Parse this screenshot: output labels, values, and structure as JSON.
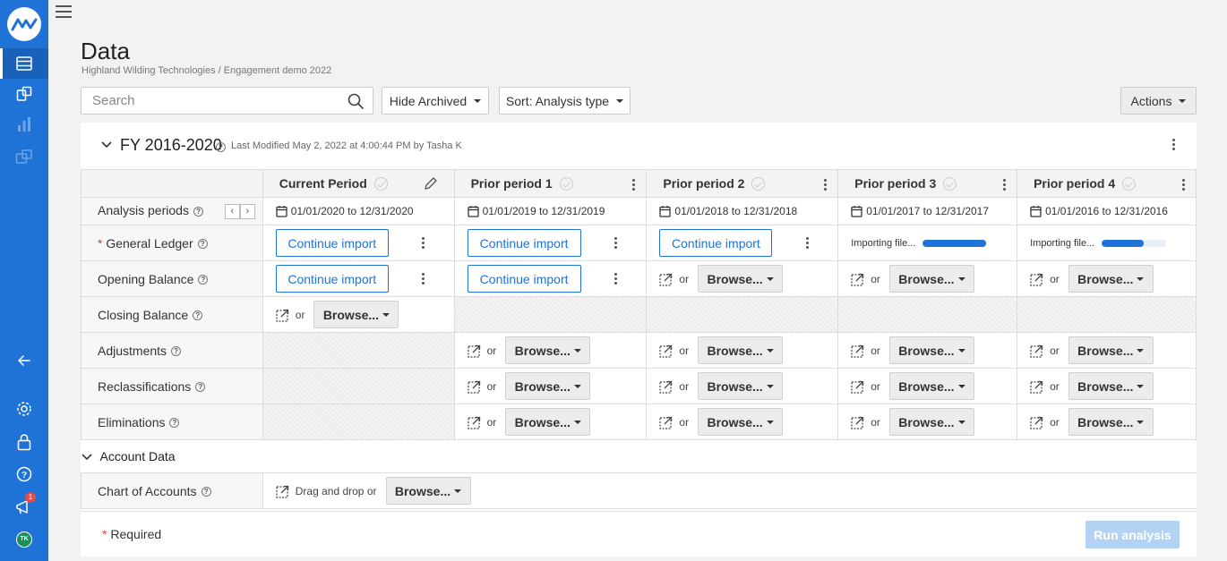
{
  "page": {
    "title": "Data",
    "breadcrumb": "Highland Wilding Technologies / Engagement demo 2022"
  },
  "toolbar": {
    "search_placeholder": "Search",
    "hide_archived": "Hide Archived",
    "sort": "Sort: Analysis type",
    "actions": "Actions"
  },
  "group": {
    "title": "FY 2016-2020",
    "meta": "Last Modified May 2, 2022 at 4:00:44 PM by Tasha K"
  },
  "columns": [
    {
      "label": "Current Period",
      "range": "01/01/2020 to 12/31/2020"
    },
    {
      "label": "Prior period 1",
      "range": "01/01/2019 to 12/31/2019"
    },
    {
      "label": "Prior period 2",
      "range": "01/01/2018 to 12/31/2018"
    },
    {
      "label": "Prior period 3",
      "range": "01/01/2017 to 12/31/2017"
    },
    {
      "label": "Prior period 4",
      "range": "01/01/2016 to 12/31/2016"
    }
  ],
  "rows": {
    "analysis_periods": "Analysis periods",
    "general_ledger": "General Ledger",
    "opening_balance": "Opening Balance",
    "closing_balance": "Closing Balance",
    "adjustments": "Adjustments",
    "reclassifications": "Reclassifications",
    "eliminations": "Eliminations"
  },
  "labels": {
    "continue_import": "Continue import",
    "browse": "Browse...",
    "or": "or",
    "importing": "Importing file...",
    "drag_drop": "Drag and drop or",
    "required_mark": "*",
    "required_note": "Required",
    "run_analysis": "Run analysis"
  },
  "progress": {
    "prior3": 0.98,
    "prior4": 0.65
  },
  "account_data": {
    "title": "Account Data",
    "chart_of_accounts": "Chart of Accounts"
  },
  "sidebar": {
    "avatar_initials": "TK",
    "notification_count": "1"
  },
  "colors": {
    "brand": "#1f72d6",
    "required": "#d9443f"
  }
}
